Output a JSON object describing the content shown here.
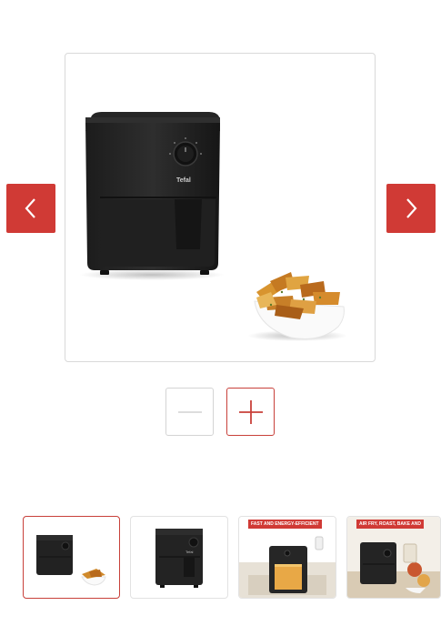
{
  "gallery": {
    "main_image": {
      "brand_text": "Tefal",
      "alt": "Tefal air fryer with potato wedges"
    },
    "prev_icon": "chevron-left-icon",
    "next_icon": "chevron-right-icon",
    "zoom": {
      "out_icon": "minus-icon",
      "in_icon": "plus-icon"
    },
    "accent_color": "#d03a35",
    "thumbnails": [
      {
        "id": "thumb-1",
        "active": true
      },
      {
        "id": "thumb-2",
        "active": false,
        "brand_text": "Tefal"
      },
      {
        "id": "thumb-3",
        "active": false,
        "banner": "FAST AND ENERGY-EFFICIENT"
      },
      {
        "id": "thumb-4",
        "active": false,
        "banner": "AIR FRY, ROAST, BAKE AND"
      }
    ]
  }
}
